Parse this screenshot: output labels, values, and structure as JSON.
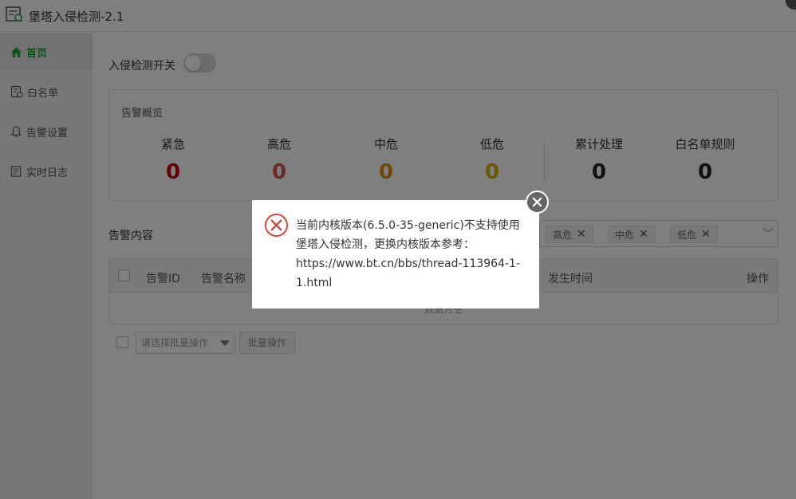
{
  "window": {
    "title": "堡塔入侵检测-2.1"
  },
  "sidebar": {
    "items": [
      {
        "label": "首页",
        "icon": "home-icon",
        "active": true
      },
      {
        "label": "白名单",
        "icon": "whitelist-icon",
        "active": false
      },
      {
        "label": "告警设置",
        "icon": "bell-icon",
        "active": false
      },
      {
        "label": "实时日志",
        "icon": "log-icon",
        "active": false
      }
    ]
  },
  "main": {
    "switch_label": "入侵检测开关",
    "switch_on": false,
    "overview": {
      "title": "告警概览",
      "stats": [
        {
          "label": "紧急",
          "value": "0",
          "color": "#c00000"
        },
        {
          "label": "高危",
          "value": "0",
          "color": "#d9534f"
        },
        {
          "label": "中危",
          "value": "0",
          "color": "#e08e0b"
        },
        {
          "label": "低危",
          "value": "0",
          "color": "#d4b000"
        },
        {
          "label": "累计处理",
          "value": "0",
          "color": "#222222"
        },
        {
          "label": "白名单规则",
          "value": "0",
          "color": "#222222"
        }
      ]
    },
    "content_title": "告警内容",
    "filter_tags": [
      "高危",
      "中危",
      "低危"
    ],
    "table": {
      "columns": [
        "告警ID",
        "告警名称",
        "发生时间",
        "操作"
      ],
      "empty_text": "数据为空"
    },
    "batch_select_placeholder": "请选择批量操作",
    "batch_button": "批量操作"
  },
  "dialog": {
    "message_line1": "当前内核版本(6.5.0-35-generic)不支持使用",
    "message_line2": "堡塔入侵检测，更换内核版本参考：",
    "message_line3": "https://www.bt.cn/bbs/thread-113964-1-",
    "message_line4": "1.html"
  },
  "colors": {
    "accent": "#20a53a",
    "error": "#e03c31"
  }
}
